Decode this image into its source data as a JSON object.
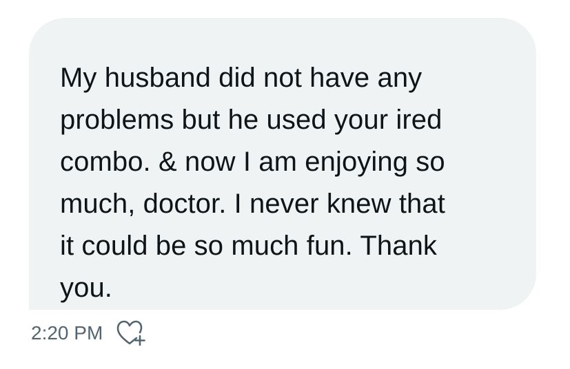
{
  "message": {
    "text": "My husband did not have any\nproblems but he used your ired\ncombo. & now I am enjoying so\nmuch, doctor. I never knew that\nit could be so much fun. Thank\nyou.",
    "timestamp": "2:20 PM",
    "reaction_icon": "heart-plus-icon"
  },
  "colors": {
    "bubble_background": "#eff3f4",
    "text": "#0f1419",
    "meta_text": "#536471"
  }
}
